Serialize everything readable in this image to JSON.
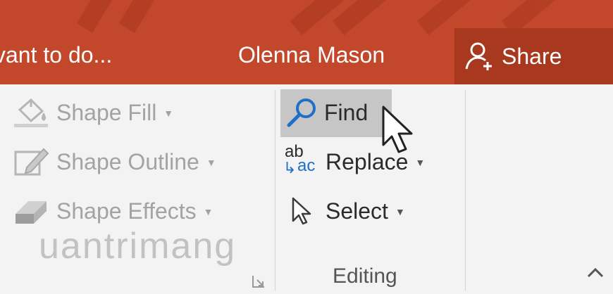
{
  "titlebar": {
    "tell_me": "vant to do...",
    "user_name": "Olenna Mason",
    "share_label": "Share",
    "bg_color": "#c3472a"
  },
  "drawing_group": {
    "commands": [
      {
        "label": "Shape Fill",
        "icon": "paint-bucket-icon",
        "enabled": false
      },
      {
        "label": "Shape Outline",
        "icon": "pencil-outline-icon",
        "enabled": false
      },
      {
        "label": "Shape Effects",
        "icon": "shape-effects-icon",
        "enabled": false
      }
    ]
  },
  "editing_group": {
    "label": "Editing",
    "commands": [
      {
        "label": "Find",
        "icon": "magnifier-icon",
        "hovered": true
      },
      {
        "label": "Replace",
        "icon": "replace-ab-ac-icon",
        "icon_text_top": "ab",
        "icon_text_bottom": "ac"
      },
      {
        "label": "Select",
        "icon": "select-cursor-icon"
      }
    ]
  },
  "watermark": "uantrimang"
}
